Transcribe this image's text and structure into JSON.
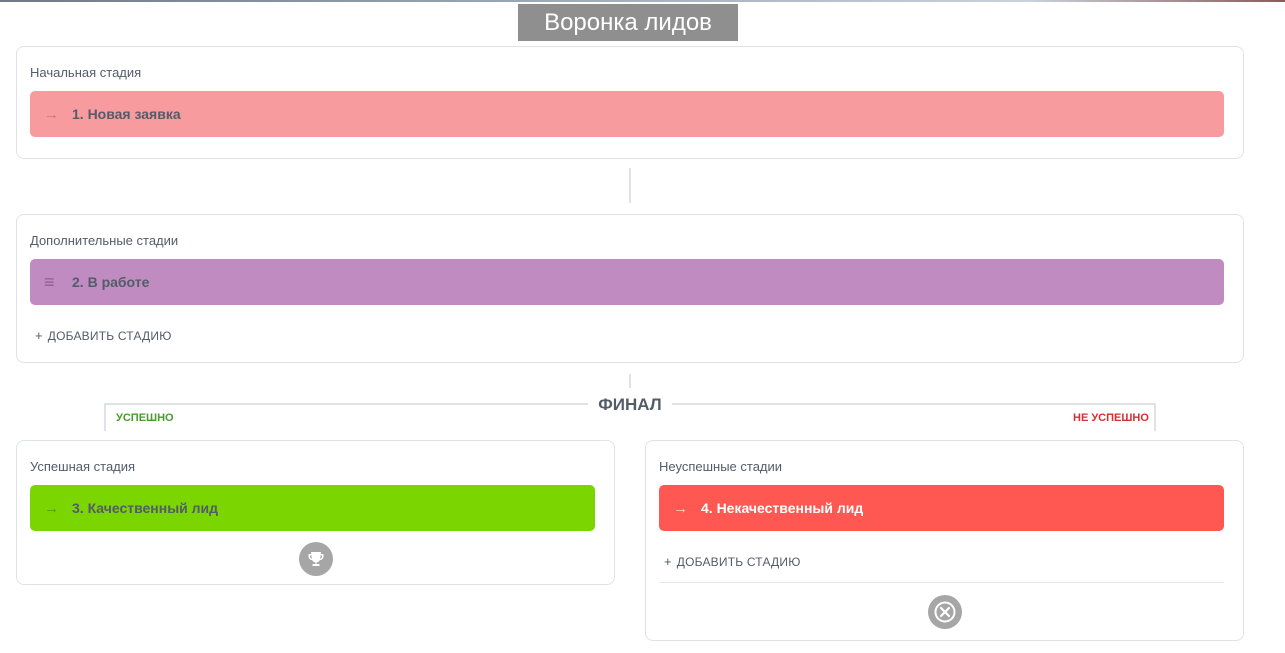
{
  "page": {
    "title": "Воронка лидов"
  },
  "initial": {
    "label": "Начальная стадия",
    "stage": {
      "glyph": "→",
      "name": "1. Новая заявка",
      "color": "#f79b9e",
      "text_color": "#535c69"
    }
  },
  "extra": {
    "label": "Дополнительные стадии",
    "stage": {
      "glyph": "≡",
      "name": "2. В работе",
      "color": "#bf8bc1",
      "text_color": "#535c69"
    },
    "add_label": "ДОБАВИТЬ СТАДИЮ"
  },
  "final": {
    "title": "ФИНАЛ",
    "success_label": "УСПЕШНО",
    "fail_label": "НЕ УСПЕШНО"
  },
  "success": {
    "label": "Успешная стадия",
    "stage": {
      "glyph": "→",
      "name": "3. Качественный лид",
      "color": "#7bd500",
      "text_color": "#535c69"
    },
    "icon": "trophy-icon"
  },
  "fail": {
    "label": "Неуспешные стадии",
    "stage": {
      "glyph": "→",
      "name": "4. Некачественный лид",
      "color": "#ff5752",
      "text_color": "#ffffff"
    },
    "add_label": "ДОБАВИТЬ СТАДИЮ",
    "icon": "close-circle-icon"
  }
}
